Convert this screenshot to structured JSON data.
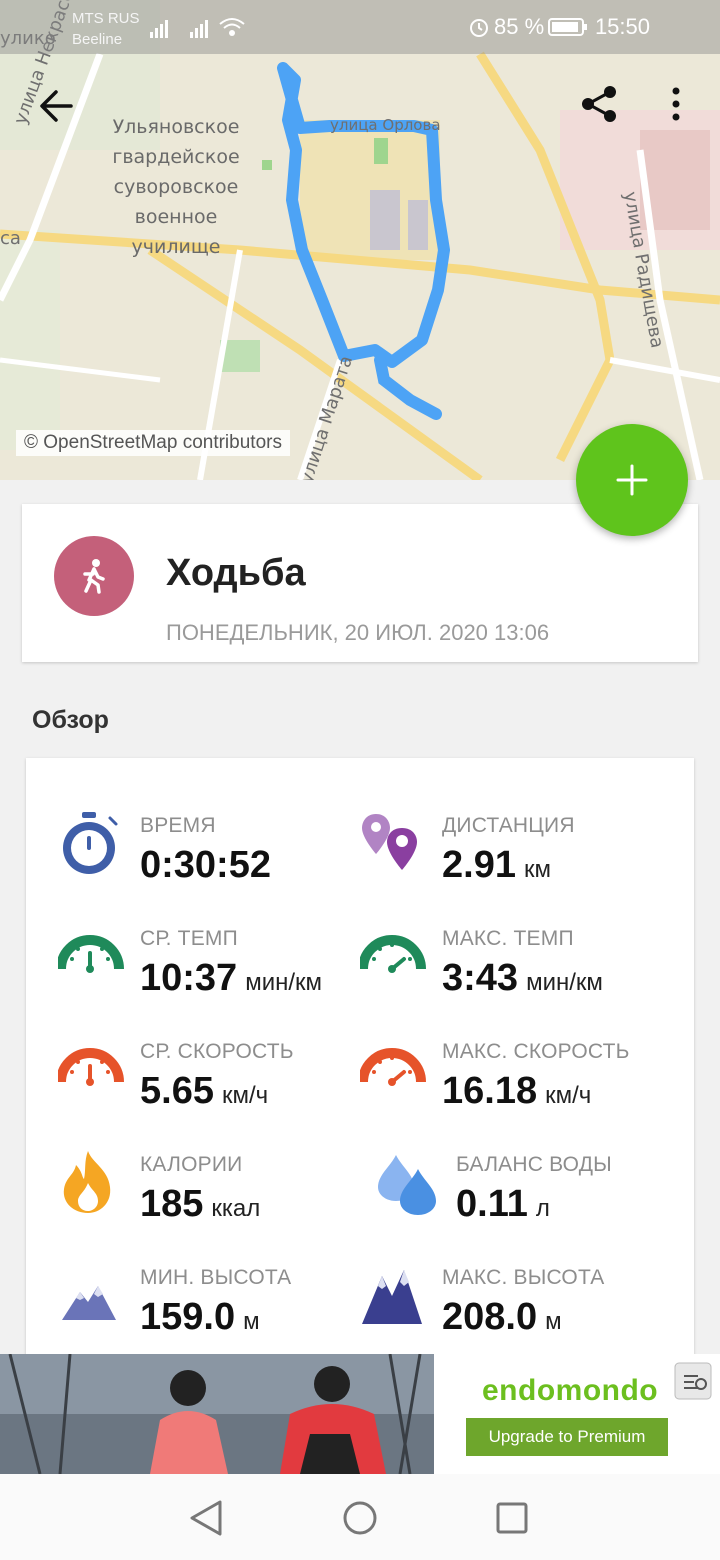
{
  "status_bar": {
    "carrier1": "MTS RUS",
    "carrier2": "Beeline",
    "battery": "85 %",
    "time": "15:50"
  },
  "map": {
    "labels": {
      "school_line1": "Ульяновское",
      "school_line2": "гвардейское",
      "school_line3": "суворовское",
      "school_line4": "военное",
      "school_line5": "училище",
      "street_nekrasova": "улица Некрасова",
      "street_radishcheva": "улица Радищева",
      "street_marata": "улица Марата",
      "street_orlova": "улица Орлова",
      "top_left": "улико",
      "left_edge": "са"
    },
    "attribution": "© OpenStreetMap contributors",
    "route_color": "#4da3f5"
  },
  "toolbar": {
    "back_icon": "arrow-left-icon",
    "share_icon": "share-icon",
    "menu_icon": "more-vert-icon"
  },
  "fab": {
    "icon": "plus-icon",
    "color": "#5fc41c"
  },
  "activity": {
    "title": "Ходьба",
    "date": "ПОНЕДЕЛЬНИК, 20 ИЮЛ. 2020 13:06",
    "icon": "walking-icon",
    "color": "#c4607a"
  },
  "overview_title": "Обзор",
  "stats": {
    "time": {
      "label": "ВРЕМЯ",
      "value": "0:30:52",
      "unit": ""
    },
    "distance": {
      "label": "ДИСТАНЦИЯ",
      "value": "2.91",
      "unit": "км"
    },
    "avg_pace": {
      "label": "СР. ТЕМП",
      "value": "10:37",
      "unit": "мин/км"
    },
    "max_pace": {
      "label": "МАКС. ТЕМП",
      "value": "3:43",
      "unit": "мин/км"
    },
    "avg_speed": {
      "label": "СР. СКОРОСТЬ",
      "value": "5.65",
      "unit": "км/ч"
    },
    "max_speed": {
      "label": "МАКС. СКОРОСТЬ",
      "value": "16.18",
      "unit": "км/ч"
    },
    "calories": {
      "label": "КАЛОРИИ",
      "value": "185",
      "unit": "ккал"
    },
    "water": {
      "label": "БАЛАНС ВОДЫ",
      "value": "0.11",
      "unit": "л"
    },
    "min_alt": {
      "label": "МИН. ВЫСОТА",
      "value": "159.0",
      "unit": "м"
    },
    "max_alt": {
      "label": "МАКС. ВЫСОТА",
      "value": "208.0",
      "unit": "м"
    }
  },
  "banner": {
    "brand": "endomondo",
    "button": "Upgrade to Premium"
  },
  "colors": {
    "time_icon": "#3f5ea8",
    "distance_icon": "#8a3fa0",
    "pace_icon": "#1f8a5a",
    "speed_icon": "#e6532a",
    "calories_icon": "#f5a623",
    "water_icon": "#4a90e2",
    "altitude_icon": "#3a3f8f"
  }
}
